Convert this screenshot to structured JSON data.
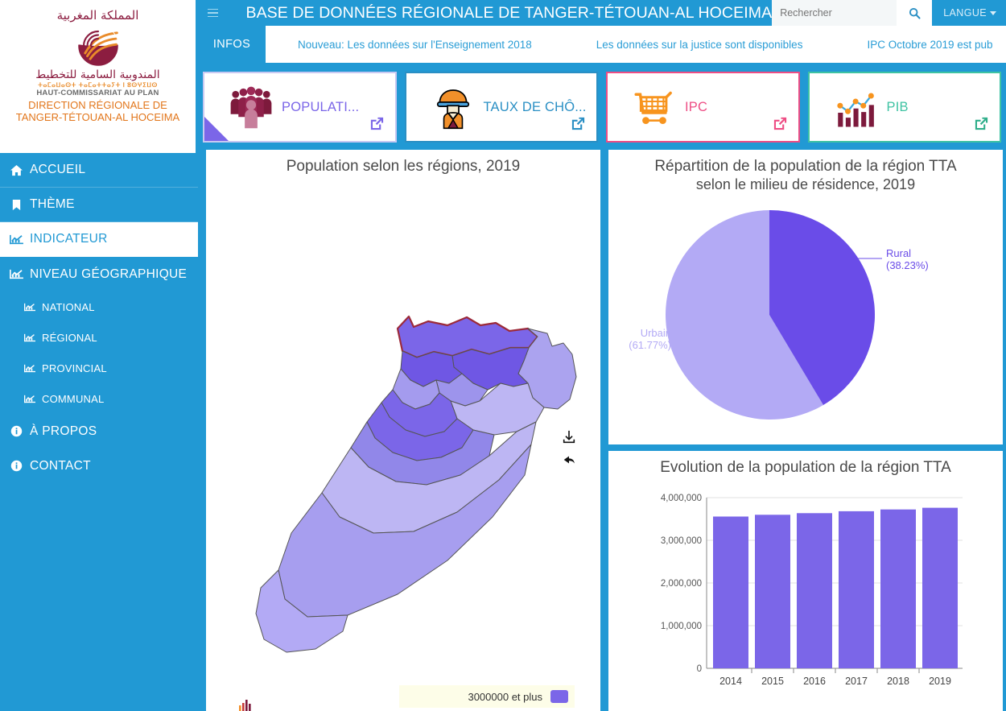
{
  "brand": {
    "arabic_top": "المملكة المغربية",
    "arabic_mid": "المندوبية السامية للتخطيط",
    "tifinagh": "ⵜⴰⵎⴰⵡⴰⵙⵜ ⵜⴰⵎⴰⵜⵜⴰⵢⵜ ⵏ ⵓⵙⵖⵉⵡⵙ",
    "hcp": "HAUT-COMMISSARIAT AU PLAN",
    "direction": "DIRECTION RÉGIONALE DE\nTANGER-TÉTOUAN-AL HOCEIMA"
  },
  "topbar": {
    "title": "BASE DE DONNÉES RÉGIONALE DE TANGER-TÉTOUAN-AL HOCEIMA",
    "search_placeholder": "Rechercher",
    "search_value": "",
    "language_label": "LANGUE",
    "menu_toggle": "hamburger-icon",
    "search_icon": "search-icon"
  },
  "ticker": {
    "label": "INFOS",
    "items": [
      "Nouveau: Les données sur l'Enseignement 2018",
      "Les données sur la justice sont disponibles",
      "IPC Octobre 2019 est pub"
    ]
  },
  "kpis": [
    {
      "label": "POPULATI...",
      "icon": "people-group-icon",
      "accent": "#7b66e8",
      "border": "#c8c9f2",
      "has_corner": true
    },
    {
      "label": "TAUX DE CHÔ...",
      "icon": "worker-hardhat-icon",
      "accent": "#2a8fc4",
      "border": "#2a8fc4",
      "has_corner": false
    },
    {
      "label": "IPC",
      "icon": "shopping-cart-icon",
      "accent": "#ee4d84",
      "border": "#ee4d84",
      "has_corner": false
    },
    {
      "label": "PIB",
      "icon": "bar-line-chart-icon",
      "accent": "#3fc3a3",
      "border": "#3fc3a3",
      "has_corner": false
    }
  ],
  "sidebar": {
    "items": [
      {
        "label": "ACCUEIL",
        "icon": "home-icon",
        "level": "top",
        "active": false
      },
      {
        "label": "THÈME",
        "icon": "bookmark-icon",
        "level": "top",
        "active": false
      },
      {
        "label": "INDICATEUR",
        "icon": "chart-icon",
        "level": "top",
        "active": true
      },
      {
        "label": "NIVEAU GÉOGRAPHIQUE",
        "icon": "chart-icon",
        "level": "top",
        "active": false
      },
      {
        "label": "NATIONAL",
        "icon": "chart-icon",
        "level": "sub",
        "active": false
      },
      {
        "label": "RÉGIONAL",
        "icon": "chart-icon",
        "level": "sub",
        "active": false
      },
      {
        "label": "PROVINCIAL",
        "icon": "chart-icon",
        "level": "sub",
        "active": false
      },
      {
        "label": "COMMUNAL",
        "icon": "chart-icon",
        "level": "sub",
        "active": false
      },
      {
        "label": "À PROPOS",
        "icon": "info-icon",
        "level": "top",
        "active": false
      },
      {
        "label": "CONTACT",
        "icon": "info-icon",
        "level": "top",
        "active": false
      }
    ]
  },
  "panels": {
    "map": {
      "title": "Population selon les régions, 2019",
      "legend_text": "3000000 et plus",
      "legend_color": "#7b66e8",
      "tools": [
        "download-icon",
        "reset-arrow-icon"
      ]
    },
    "pie": {
      "title_line1": "Répartition  de la population de la région TTA",
      "title_line2": "selon le milieu de résidence, 2019"
    },
    "bar": {
      "title": "Evolution de la population de la région TTA"
    }
  },
  "chart_data": [
    {
      "type": "pie",
      "title": "Répartition  de la population de la région TTA selon le milieu de résidence, 2019",
      "categories": [
        "Rural",
        "Urbain"
      ],
      "values": [
        38.23,
        61.77
      ],
      "labels": [
        "Rural\n(38.23%)",
        "Urbain\n(61.77%)"
      ],
      "colors": [
        "#6a4ce8",
        "#b3aaf5"
      ],
      "unit": "%",
      "legend": "labels-outside"
    },
    {
      "type": "bar",
      "title": "Evolution de la population de la région TTA",
      "categories": [
        "2014",
        "2015",
        "2016",
        "2017",
        "2018",
        "2019"
      ],
      "values": [
        3556000,
        3597000,
        3636000,
        3680000,
        3722000,
        3762000
      ],
      "xlabel": "",
      "ylabel": "",
      "ylim": [
        0,
        4000000
      ],
      "yticks": [
        0,
        1000000,
        2000000,
        3000000,
        4000000
      ],
      "ytick_labels": [
        "0",
        "1,000,000",
        "2,000,000",
        "3,000,000",
        "4,000,000"
      ],
      "color": "#7b66e8",
      "grid": true,
      "legend": "none"
    },
    {
      "type": "choropleth",
      "title": "Population selon les régions, 2019",
      "region": "Maroc",
      "legend_bins": [
        "3000000 et plus"
      ],
      "legend_colors": [
        "#7b66e8"
      ],
      "highlighted_region": "Tanger-Tétouan-Al Hoceima",
      "highlight_outline": "#9c2a3a"
    }
  ]
}
